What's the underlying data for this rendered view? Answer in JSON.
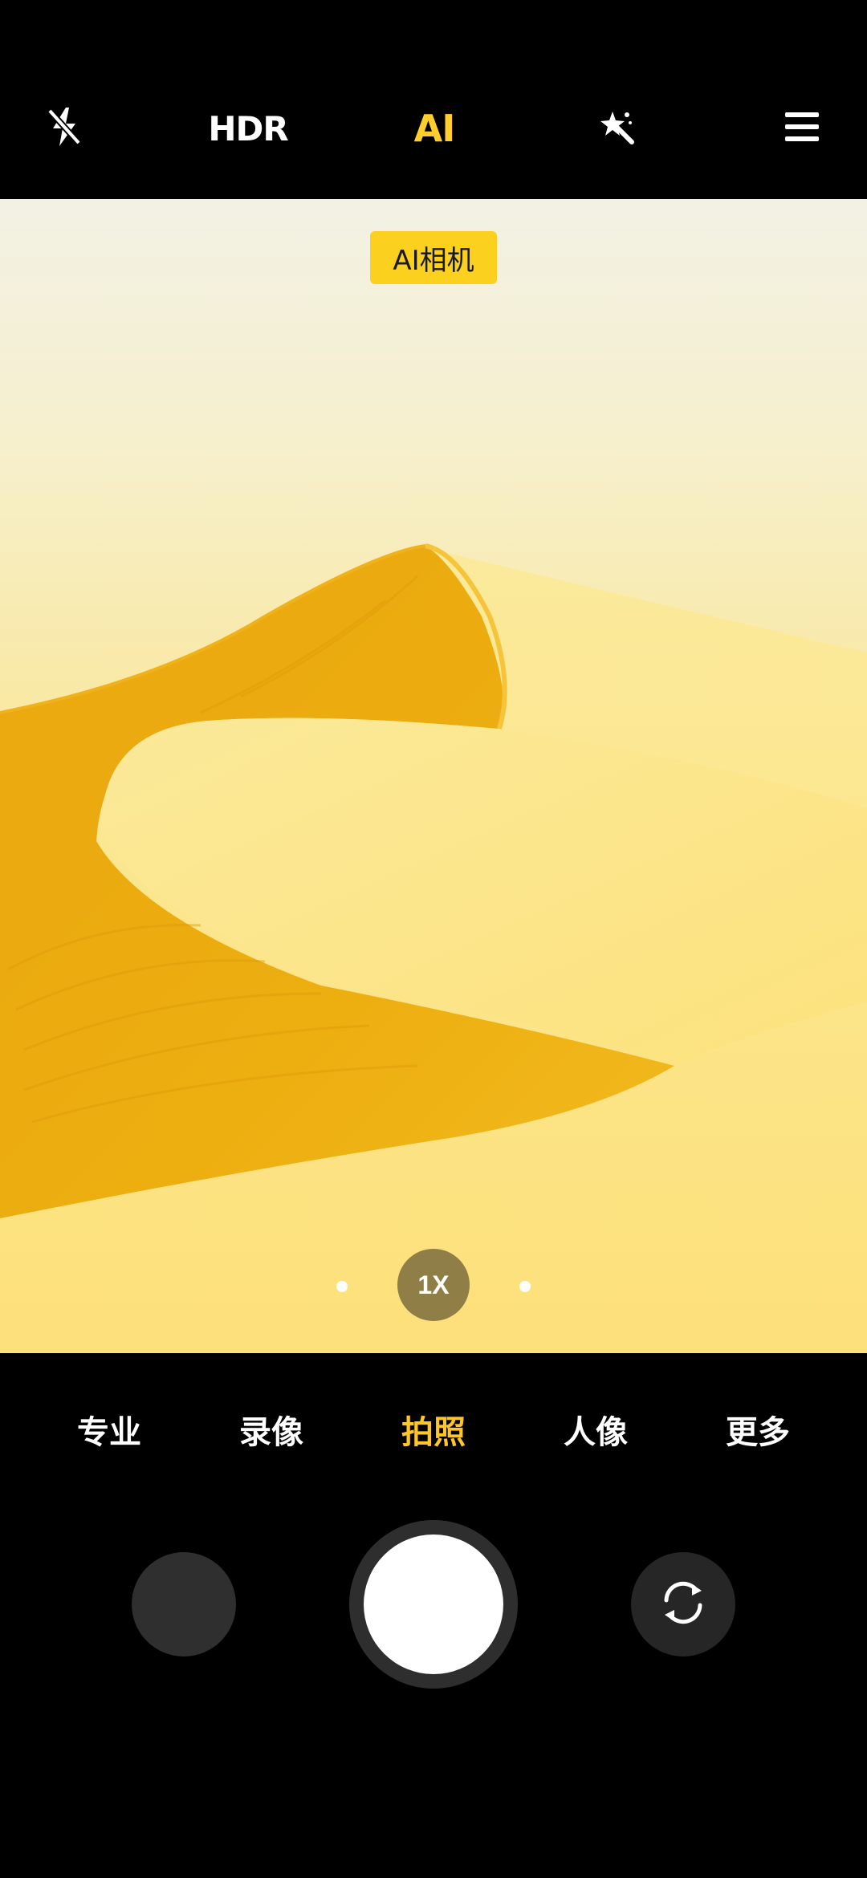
{
  "toolbar": {
    "hdr_label": "HDR",
    "ai_label": "AI",
    "icons": {
      "flash": "flash-off-icon",
      "filter": "filter-icon",
      "menu": "menu-icon"
    },
    "ai_active_color": "#ffcd2c"
  },
  "viewfinder": {
    "ai_badge": "AI相机",
    "zoom_label": "1X"
  },
  "modes": {
    "items": [
      {
        "label": "专业"
      },
      {
        "label": "录像"
      },
      {
        "label": "拍照"
      },
      {
        "label": "人像"
      },
      {
        "label": "更多"
      }
    ],
    "selected": "拍照",
    "active_color": "#ffc62c"
  },
  "controls": {
    "gallery_icon": "gallery-thumbnail",
    "shutter_icon": "shutter-button",
    "switch_icon": "switch-camera-icon"
  }
}
